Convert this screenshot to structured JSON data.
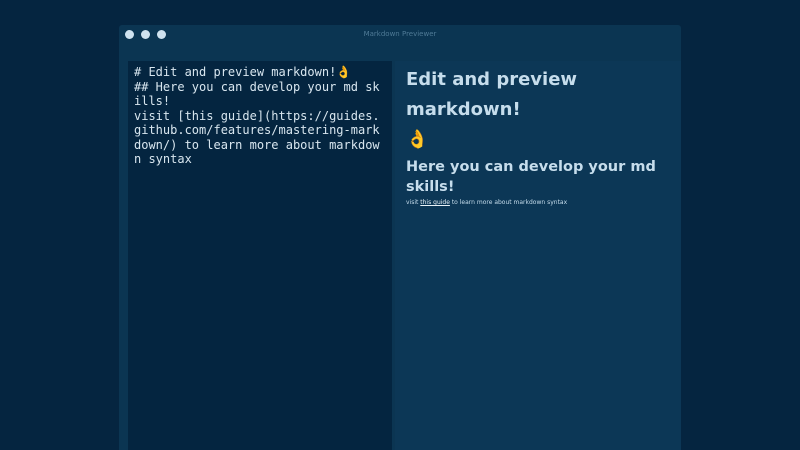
{
  "window": {
    "title": "Markdown Previewer"
  },
  "editor": {
    "content": "# Edit and preview markdown!👌\n## Here you can develop your md skills!\nvisit [this guide](https://guides.github.com/features/mastering-markdown/) to learn more about markdown syntax"
  },
  "preview": {
    "h1_text": "Edit and preview markdown!",
    "h1_emoji": "👌",
    "h2_text": "Here you can develop your md skills!",
    "p_prefix": "visit ",
    "link_text": "this guide",
    "link_href": "https://guides.github.com/features/mastering-markdown/",
    "p_suffix": " to learn more about markdown syntax"
  },
  "colors": {
    "background": "#052540",
    "window": "#0b3552",
    "editor_bg": "#042540",
    "preview_bg": "#0c3756",
    "text": "#c6ddec"
  }
}
